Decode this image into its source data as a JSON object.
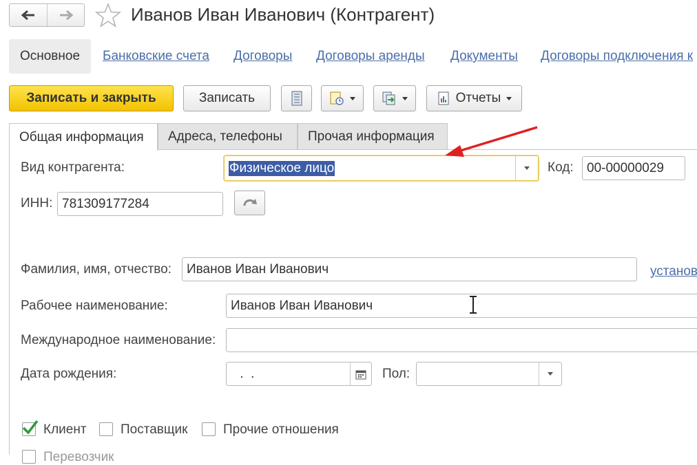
{
  "window": {
    "title": "Иванов Иван Иванович (Контрагент)"
  },
  "sections": {
    "active": "Основное",
    "links": [
      "Банковские счета",
      "Договоры",
      "Договоры аренды",
      "Документы",
      "Договоры подключения к"
    ]
  },
  "toolbar": {
    "save_close": "Записать и закрыть",
    "save": "Записать",
    "reports": "Отчеты"
  },
  "tabs": [
    "Общая информация",
    "Адреса, телефоны",
    "Прочая информация"
  ],
  "form": {
    "kind_label": "Вид контрагента:",
    "kind_value": "Физическое лицо",
    "code_label": "Код:",
    "code_value": "00-00000029",
    "inn_label": "ИНН:",
    "inn_value": "781309177284",
    "fio_label": "Фамилия, имя, отчество:",
    "fio_value": "Иванов Иван Иванович",
    "set_link": "установ",
    "work_name_label": "Рабочее наименование:",
    "work_name_value": "Иванов Иван Иванович",
    "intl_name_label": "Международное наименование:",
    "intl_name_value": "",
    "birth_label": "Дата рождения:",
    "birth_value": " .  .",
    "gender_label": "Пол:",
    "gender_value": ""
  },
  "relations": {
    "client": {
      "label": "Клиент",
      "checked": true
    },
    "supplier": {
      "label": "Поставщик",
      "checked": false
    },
    "other": {
      "label": "Прочие отношения",
      "checked": false
    },
    "carrier": {
      "label": "Перевозчик",
      "checked": false
    }
  },
  "colors": {
    "accent_yellow": "#f2c200",
    "link_blue": "#4a6ea9",
    "selection": "#3c5da6",
    "annotation_arrow": "#e02020",
    "check_green": "#2e9b3a"
  }
}
